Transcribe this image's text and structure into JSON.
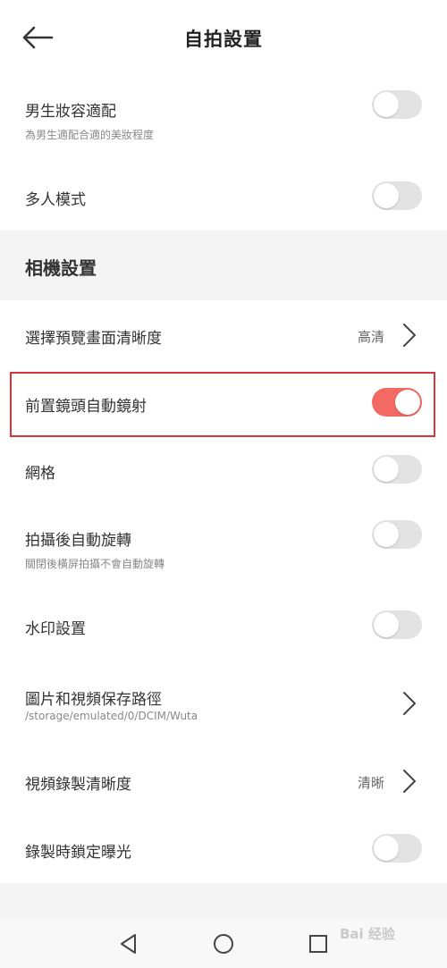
{
  "header": {
    "title": "自拍設置"
  },
  "rows": {
    "male_makeup": {
      "label": "男生妝容適配",
      "sub": "為男生適配合適的美妝程度",
      "on": false
    },
    "multi_person": {
      "label": "多人模式",
      "on": false
    },
    "preview_clarity": {
      "label": "選擇預覽畫面清晰度",
      "value": "高清"
    },
    "front_mirror": {
      "label": "前置鏡頭自動鏡射",
      "on": true
    },
    "grid": {
      "label": "網格",
      "on": false
    },
    "auto_rotate": {
      "label": "拍攝後自動旋轉",
      "sub": "關閉後橫屏拍攝不會自動旋轉",
      "on": false
    },
    "watermark": {
      "label": "水印設置",
      "on": false
    },
    "save_path": {
      "label": "圖片和視頻保存路徑",
      "sub": "/storage/emulated/0/DCIM/Wuta"
    },
    "video_clarity": {
      "label": "視頻錄製清晰度",
      "value": "清晰"
    },
    "lock_exposure": {
      "label": "錄製時鎖定曝光",
      "on": false
    }
  },
  "section": {
    "title": "相機設置"
  },
  "watermark_text": "Bai 经验",
  "colors": {
    "toggle_on": "#f26a63",
    "toggle_off": "#e3e3e3",
    "highlight": "#d9343a"
  }
}
